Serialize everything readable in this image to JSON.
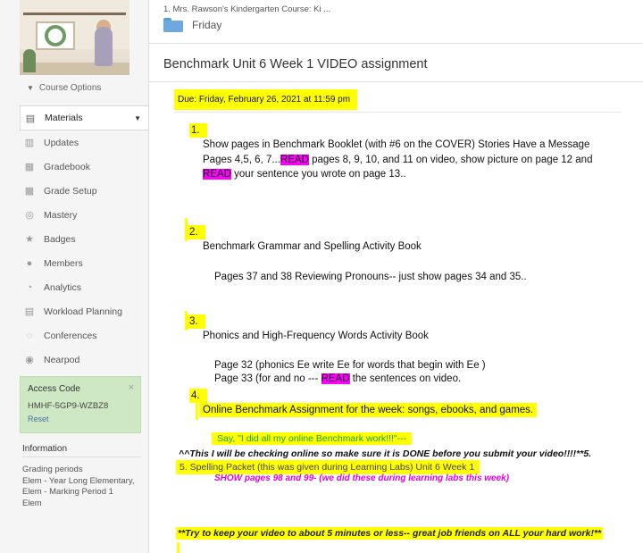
{
  "sidebar": {
    "course_options": "Course Options",
    "nav": [
      {
        "label": "Materials",
        "icon": "materials-icon",
        "glyph": "▤"
      },
      {
        "label": "Updates",
        "icon": "updates-icon",
        "glyph": "▥"
      },
      {
        "label": "Gradebook",
        "icon": "gradebook-icon",
        "glyph": "▦"
      },
      {
        "label": "Grade Setup",
        "icon": "grade-setup-icon",
        "glyph": "▩"
      },
      {
        "label": "Mastery",
        "icon": "mastery-icon",
        "glyph": "◎"
      },
      {
        "label": "Badges",
        "icon": "badges-icon",
        "glyph": "★"
      },
      {
        "label": "Members",
        "icon": "members-icon",
        "glyph": "●"
      },
      {
        "label": "Analytics",
        "icon": "analytics-icon",
        "glyph": "◔"
      },
      {
        "label": "Workload Planning",
        "icon": "workload-planning-icon",
        "glyph": "▤"
      },
      {
        "label": "Conferences",
        "icon": "conferences-icon",
        "glyph": "◌"
      },
      {
        "label": "Nearpod",
        "icon": "nearpod-icon",
        "glyph": "◉"
      }
    ],
    "access_code": {
      "title": "Access Code",
      "code": "HMHF-5GP9-WZBZ8",
      "reset": "Reset",
      "close": "×"
    },
    "information": {
      "title": "Information",
      "lines": [
        "Grading periods",
        "Elem - Year Long Elementary,",
        "Elem - Marking Period 1",
        "Elem"
      ]
    }
  },
  "header": {
    "breadcrumb": "1. Mrs. Rawson's Kindergarten Course: Ki ...",
    "folder": "Friday",
    "title": "Benchmark Unit 6 Week 1 VIDEO assignment"
  },
  "assignment": {
    "due": "Due: Friday, February 26, 2021 at 11:59 pm",
    "n1": "1.",
    "p1_a": "Show pages in Benchmark Booklet (with #6 on the COVER) Stories Have a Message    Pages 4,5, 6, 7...",
    "p1_read1": "READ",
    "p1_b": " pages 8, 9, 10, and 11 on video, show picture on page 12  and ",
    "p1_read2": "READ",
    "p1_c": " your sentence you wrote on page 13..",
    "n2": "2.",
    "p2_title": "Benchmark Grammar and Spelling Activity Book",
    "p2_line": "Pages 37 and 38 Reviewing  Pronouns-- just show pages 34 and 35..",
    "n3": "3.",
    "p3_title": "Phonics and High-Frequency Words Activity Book",
    "p3_line1": "Page 32  (phonics Ee write Ee for words that begin with Ee )",
    "p3_line2a": "Page 33  (for and no  --- ",
    "p3_read": "READ",
    "p3_line2b": " the sentences on video.",
    "n4": "4.",
    "p4_line": "Online Benchmark Assignment for the week:  songs, ebooks, and games.",
    "p4_say": "Say, \"I did all my online Benchmark work!!!\"---",
    "p4_warning": "^^This I will be checking online so make sure it is DONE before you submit your video!!!!**5.",
    "p5_line": "5. Spelling Packet (this was given during Learning Labs) Unit 6 Week 1",
    "p5_show": "SHOW pages 98 and 99- (we did these during learning labs this week)",
    "footer": "**Try to keep your video to about 5 minutes or less-- great job friends on ALL your hard work!**"
  },
  "colors": {
    "highlight": "#ffff00",
    "magenta": "#ff00ff",
    "green_text": "#1aa11a",
    "pink_text": "#e400e4"
  }
}
